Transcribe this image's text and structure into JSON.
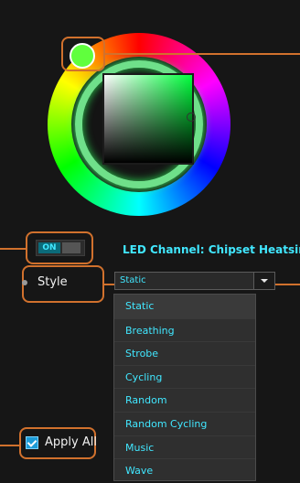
{
  "colors": {
    "background": "#161616",
    "accent_cyan": "#41e7ff",
    "callout_orange": "#d1712d",
    "selected_green": "#60ff3d"
  },
  "toggle": {
    "label": "ON",
    "state": "on"
  },
  "led_channel": {
    "text": "LED Channel: Chipset Heatsink"
  },
  "style": {
    "label": "Style",
    "selected": "Static"
  },
  "style_options": [
    "Static",
    "Breathing",
    "Strobe",
    "Cycling",
    "Random",
    "Random Cycling",
    "Music",
    "Wave"
  ],
  "apply_all": {
    "label": "Apply All",
    "checked": true
  },
  "icons": {
    "dropdown": "chevron-down-icon",
    "checkbox": "checkmark-icon"
  }
}
